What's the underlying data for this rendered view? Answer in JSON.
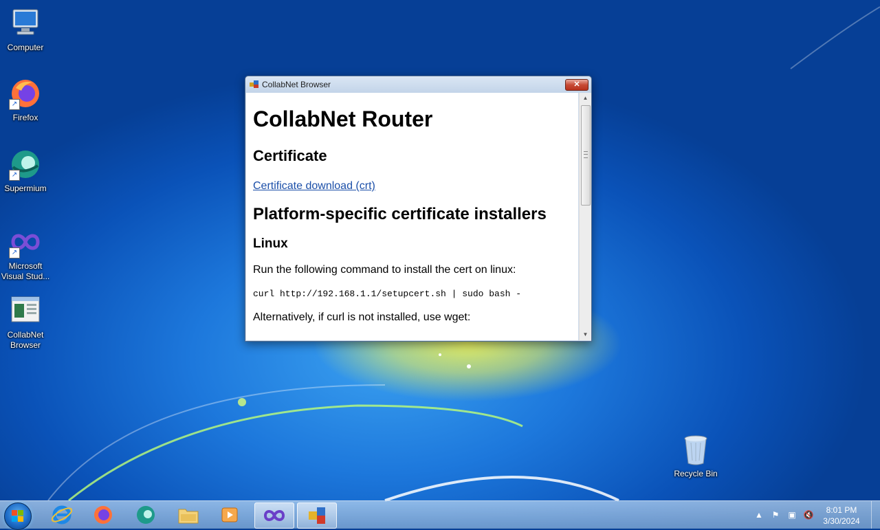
{
  "desktop": {
    "icons": [
      {
        "label": "Computer"
      },
      {
        "label": "Firefox"
      },
      {
        "label": "Supermium"
      },
      {
        "label": "Microsoft Visual Stud..."
      },
      {
        "label": "CollabNet Browser"
      },
      {
        "label": "Recycle Bin"
      }
    ]
  },
  "window": {
    "title": "CollabNet Browser",
    "close_label": "✕",
    "content": {
      "h1": "CollabNet Router",
      "section_certificate": "Certificate",
      "cert_link": "Certificate download (crt)",
      "section_installers": "Platform-specific certificate installers",
      "linux_heading": "Linux",
      "linux_text": "Run the following command to install the cert on linux:",
      "linux_command": "curl http://192.168.1.1/setupcert.sh | sudo bash -",
      "alt_text": "Alternatively, if curl is not installed, use wget:"
    }
  },
  "taskbar": {
    "apps": [
      "internet-explorer",
      "firefox",
      "supermium",
      "file-explorer",
      "media-player",
      "visual-studio",
      "collabnet-browser"
    ],
    "clock_time": "8:01 PM",
    "clock_date": "3/30/2024"
  }
}
